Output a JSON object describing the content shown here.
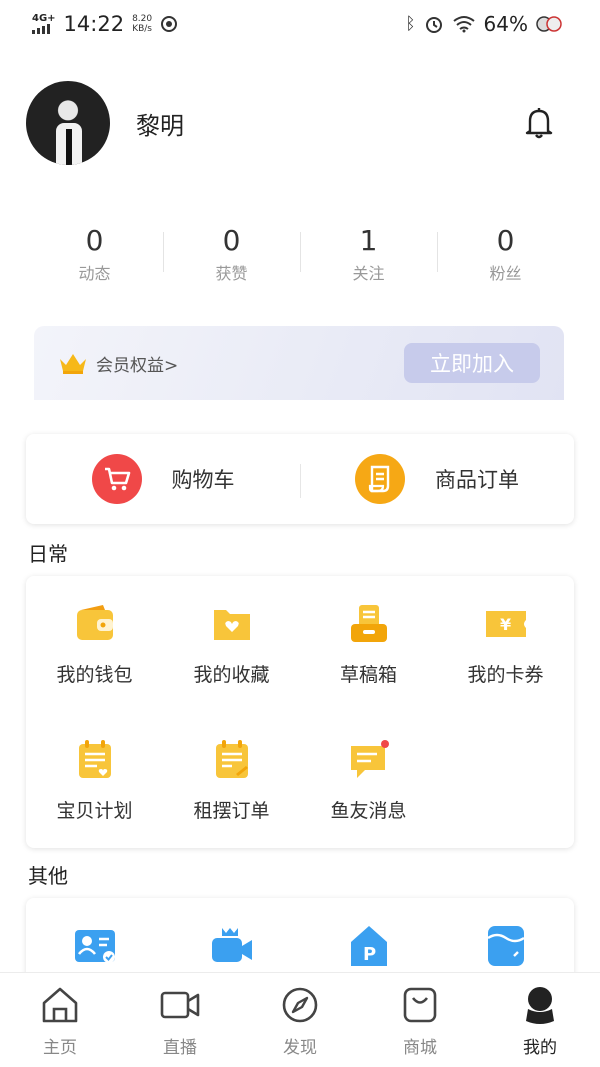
{
  "status_bar": {
    "network": "4G+",
    "time": "14:22",
    "speed_value": "8.20",
    "speed_unit": "KB/s",
    "battery": "64%"
  },
  "profile": {
    "username": "黎明"
  },
  "stats": [
    {
      "value": "0",
      "label": "动态"
    },
    {
      "value": "0",
      "label": "获赞"
    },
    {
      "value": "1",
      "label": "关注"
    },
    {
      "value": "0",
      "label": "粉丝"
    }
  ],
  "member": {
    "text": "会员权益>",
    "button": "立即加入"
  },
  "shop": [
    {
      "label": "购物车",
      "icon": "cart-icon"
    },
    {
      "label": "商品订单",
      "icon": "order-icon"
    }
  ],
  "sections": {
    "daily": "日常",
    "other": "其他"
  },
  "daily_items": [
    {
      "label": "我的钱包",
      "icon": "wallet-icon"
    },
    {
      "label": "我的收藏",
      "icon": "favorites-folder-icon"
    },
    {
      "label": "草稿箱",
      "icon": "draft-box-icon"
    },
    {
      "label": "我的卡券",
      "icon": "coupon-icon"
    },
    {
      "label": "宝贝计划",
      "icon": "plan-icon"
    },
    {
      "label": "租摆订单",
      "icon": "rental-order-icon"
    },
    {
      "label": "鱼友消息",
      "icon": "message-icon"
    }
  ],
  "other_items": [
    {
      "icon": "id-card-icon"
    },
    {
      "icon": "video-camera-icon"
    },
    {
      "icon": "parking-house-icon"
    },
    {
      "icon": "water-tank-icon"
    }
  ],
  "nav": [
    {
      "label": "主页",
      "icon": "home-icon"
    },
    {
      "label": "直播",
      "icon": "live-icon"
    },
    {
      "label": "发现",
      "icon": "compass-icon"
    },
    {
      "label": "商城",
      "icon": "mall-bag-icon"
    },
    {
      "label": "我的",
      "icon": "me-icon"
    }
  ],
  "colors": {
    "accent_orange": "#f6a815",
    "accent_red": "#f04848",
    "icon_yellow": "#f8c53a",
    "icon_blue": "#3ba0f0"
  }
}
